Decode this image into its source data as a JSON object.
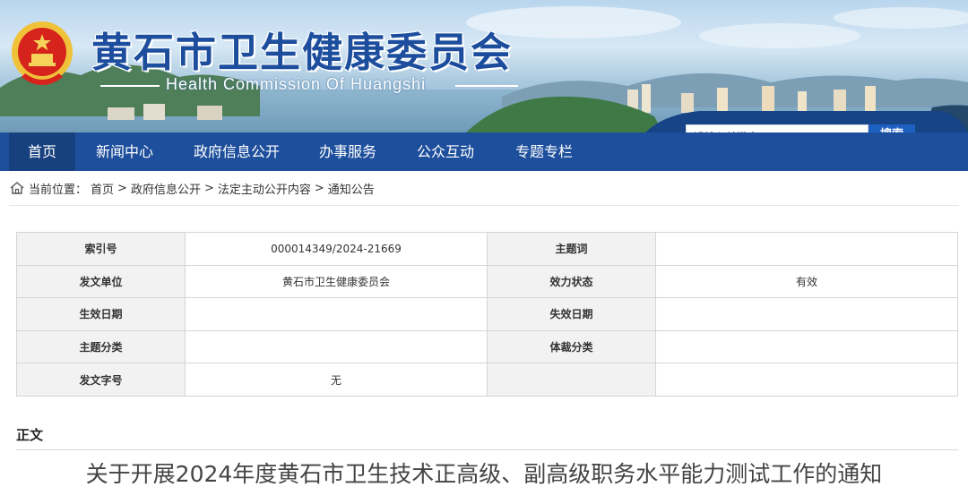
{
  "header": {
    "site_title": "黄石市卫生健康委员会",
    "site_subtitle": "Health Commission Of Huangshi"
  },
  "nav": {
    "items": [
      {
        "label": "首页",
        "active": true
      },
      {
        "label": "新闻中心"
      },
      {
        "label": "政府信息公开"
      },
      {
        "label": "办事服务"
      },
      {
        "label": "公众互动"
      },
      {
        "label": "专题专栏"
      }
    ]
  },
  "search": {
    "placeholder": "请输入关键字",
    "button_label": "搜索"
  },
  "breadcrumb": {
    "prefix": "当前位置：",
    "items": [
      "首页",
      "政府信息公开",
      "法定主动公开内容",
      "通知公告"
    ],
    "separator": ">"
  },
  "meta_table": {
    "rows": [
      [
        {
          "label": "索引号",
          "value": "000014349/2024-21669"
        },
        {
          "label": "主题词",
          "value": ""
        }
      ],
      [
        {
          "label": "发文单位",
          "value": "黄石市卫生健康委员会"
        },
        {
          "label": "效力状态",
          "value": "有效"
        }
      ],
      [
        {
          "label": "生效日期",
          "value": ""
        },
        {
          "label": "失效日期",
          "value": ""
        }
      ],
      [
        {
          "label": "主题分类",
          "value": ""
        },
        {
          "label": "体裁分类",
          "value": ""
        }
      ],
      [
        {
          "label": "发文字号",
          "value": "无"
        },
        {
          "label": "",
          "value": ""
        }
      ]
    ]
  },
  "body": {
    "section_label": "正文",
    "article_title": "关于开展2024年度黄石市卫生技术正高级、副高级职务水平能力测试工作的通知"
  },
  "colors": {
    "nav_bg": "#1e4f9c",
    "nav_active_bg": "#17407e",
    "title_blue": "#1d4e9e",
    "search_button": "#1e5fc2"
  },
  "icons": {
    "emblem": "national-emblem-icon",
    "home": "home-icon"
  }
}
